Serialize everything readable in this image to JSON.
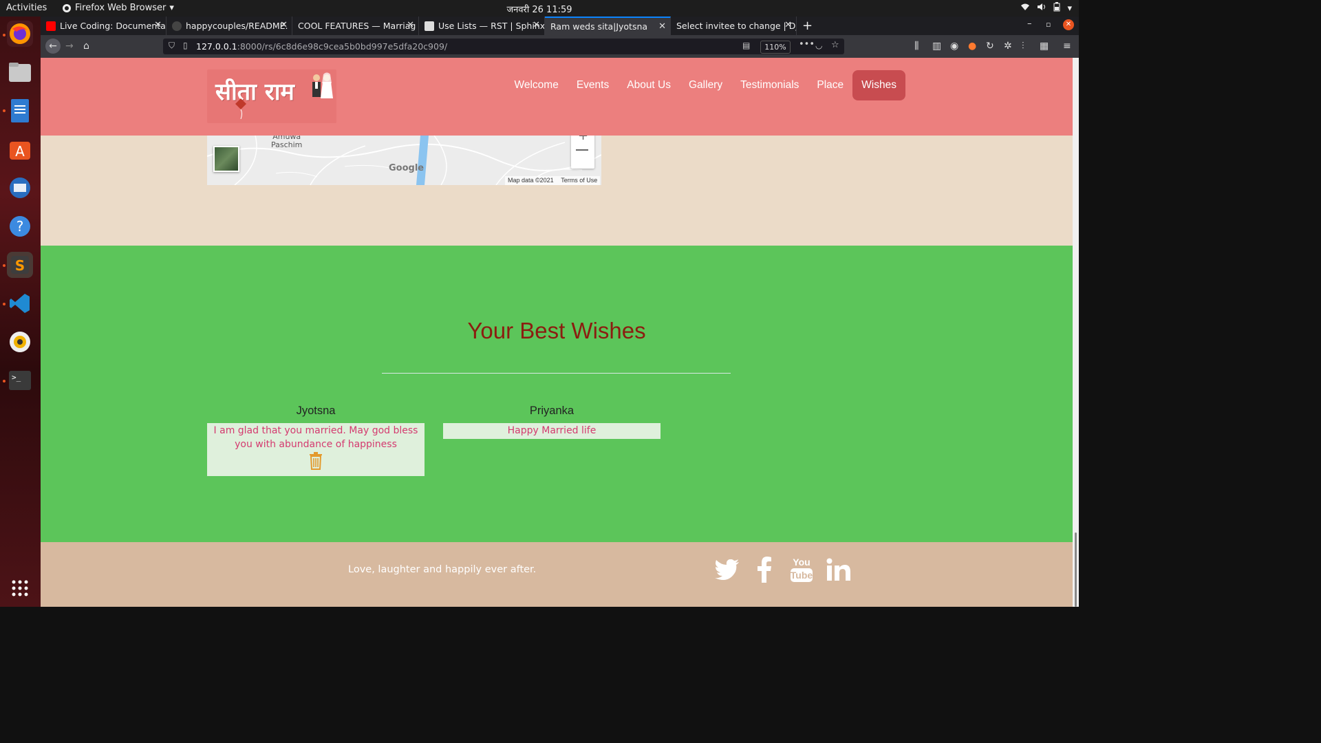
{
  "system": {
    "activities": "Activities",
    "app_name": "Firefox Web Browser",
    "clock": "जनवरी 26  11:59"
  },
  "browser": {
    "tabs": [
      {
        "title": "Live Coding: Documentat",
        "active": false
      },
      {
        "title": "happycouples/README.",
        "active": false
      },
      {
        "title": "COOL FEATURES — Marriag",
        "active": false
      },
      {
        "title": "Use Lists — RST | Sphinx",
        "active": false
      },
      {
        "title": "Ram weds sita|Jyotsna",
        "active": true
      },
      {
        "title": "Select invitee to change | Dj",
        "active": false
      }
    ],
    "url_host": "127.0.0.1",
    "url_rest": ":8000/rs/6c8d6e98c9cea5b0bd997e5dfa20c909/",
    "zoom": "110%"
  },
  "site": {
    "logo_text": "सीता राम",
    "nav": [
      "Welcome",
      "Events",
      "About Us",
      "Gallery",
      "Testimonials",
      "Place",
      "Wishes"
    ],
    "active_nav": "Wishes"
  },
  "map": {
    "place_label_1": "Amuwa",
    "place_label_2": "Paschim",
    "google": "Google",
    "attribution": "Map data ©2021",
    "terms": "Terms of Use"
  },
  "wishes": {
    "title": "Your Best Wishes",
    "items": [
      {
        "name": "Jyotsna",
        "message": "I am glad that you married. May god bless you with abundance of happiness",
        "deletable": true
      },
      {
        "name": "Priyanka",
        "message": "Happy Married life",
        "deletable": false
      }
    ]
  },
  "footer": {
    "slogan": "Love, laughter and happily ever after.",
    "social": [
      "twitter-icon",
      "facebook-icon",
      "youtube-icon",
      "linkedin-icon"
    ]
  },
  "colors": {
    "header": "#ec7f7e",
    "active_nav": "#c84c50",
    "wishes_bg": "#5cc55a",
    "wishes_title": "#8b1d10",
    "wish_text": "#d43a6f",
    "footer": "#d7b99f"
  }
}
